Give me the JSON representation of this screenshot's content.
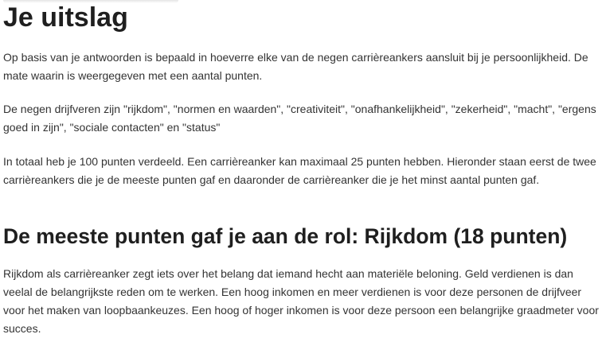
{
  "main": {
    "title": "Je uitslag",
    "intro_paragraphs": [
      "Op basis van je antwoorden is bepaald in hoeverre elke van de negen carrièreankers aansluit bij je persoonlijkheid. De mate waarin is weergegeven met een aantal punten.",
      "De negen drijfveren zijn \"rijkdom\", \"normen en waarden\", \"creativiteit\", \"onafhankelijkheid\", \"zekerheid\", \"macht\", \"ergens goed in zijn\", \"sociale contacten\" en \"status\"",
      "In totaal heb je 100 punten verdeeld. Een carrièreanker kan maximaal 25 punten hebben. Hieronder staan eerst de twee carrièreankers die je de meeste punten gaf en daaronder de carrièreanker die je het minst aantal punten gaf."
    ],
    "section": {
      "heading": "De meeste punten gaf je aan de rol: Rijkdom (18 punten)",
      "body": "Rijkdom als carrièreanker zegt iets over het belang dat iemand hecht aan materiële beloning. Geld verdienen is dan veelal de belangrijkste reden om te werken. Een hoog inkomen en meer verdienen is voor deze personen de drijfveer voor het maken van loopbaankeuzes. Een hoog of hoger inkomen is voor deze persoon een belangrijke graadmeter voor succes."
    }
  }
}
